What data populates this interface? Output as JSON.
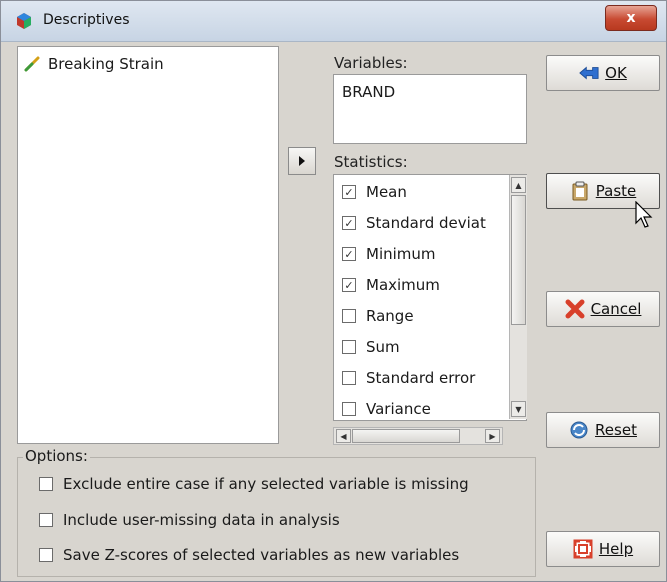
{
  "window": {
    "title": "Descriptives",
    "close_label": "x",
    "app_icon": "spss-dialog-icon"
  },
  "source_list": {
    "items": [
      {
        "label": "Breaking Strain",
        "icon": "scale-variable-ruler-icon"
      }
    ]
  },
  "variables": {
    "label": "Variables:",
    "items": [
      "BRAND"
    ]
  },
  "move_button": {
    "icon": "arrow-right-icon"
  },
  "statistics": {
    "label": "Statistics:",
    "items": [
      {
        "label": "Mean",
        "checked": true
      },
      {
        "label": "Standard deviat",
        "checked": true
      },
      {
        "label": "Minimum",
        "checked": true
      },
      {
        "label": "Maximum",
        "checked": true
      },
      {
        "label": "Range",
        "checked": false
      },
      {
        "label": "Sum",
        "checked": false
      },
      {
        "label": "Standard error",
        "checked": false
      },
      {
        "label": "Variance",
        "checked": false
      }
    ]
  },
  "buttons": {
    "ok": "OK",
    "paste": "Paste",
    "cancel": "Cancel",
    "reset": "Reset",
    "help": "Help"
  },
  "options": {
    "label": "Options:",
    "items": [
      {
        "label": "Exclude entire case if any selected variable is missing",
        "checked": false
      },
      {
        "label": "Include user-missing data in analysis",
        "checked": false
      },
      {
        "label": "Save Z-scores of selected variables as new variables",
        "checked": false
      }
    ]
  },
  "colors": {
    "dialog_bg": "#d8d5cf",
    "titlebar": "#c7d4e4",
    "close_red": "#c84a32",
    "cancel_red": "#d8402b",
    "ok_blue": "#2f6fcf"
  }
}
